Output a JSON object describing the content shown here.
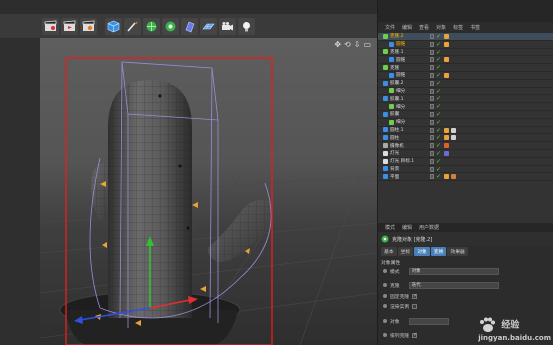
{
  "toolbar": {
    "icons": [
      "film-clapper-icon",
      "film-play-icon",
      "film-settings-icon",
      "cube-icon",
      "brush-icon",
      "subdivide-icon",
      "atom-array-icon",
      "deformer-icon",
      "floor-grid-icon",
      "camera-icon",
      "light-bulb-icon"
    ]
  },
  "viewport": {
    "nav_icons": [
      "✥",
      "⟲",
      "⇩",
      "▭"
    ]
  },
  "object_manager": {
    "menu": [
      "文件",
      "编辑",
      "查看",
      "对象",
      "标签",
      "书签"
    ],
    "rows": [
      {
        "name": "克隆.2",
        "indent": 0,
        "icon_color": "#6fce4c",
        "highlight": true,
        "selected": true,
        "tags": [
          "#e8a33a"
        ]
      },
      {
        "name": "圆锥",
        "indent": 1,
        "icon_color": "#3a8ee6",
        "highlight": true,
        "selected": false,
        "tags": [
          "#e8a33a"
        ]
      },
      {
        "name": "克隆.1",
        "indent": 0,
        "icon_color": "#6fce4c",
        "highlight": false,
        "selected": false,
        "tags": []
      },
      {
        "name": "圆锥",
        "indent": 1,
        "icon_color": "#3a8ee6",
        "highlight": false,
        "selected": false,
        "tags": [
          "#e8a33a"
        ]
      },
      {
        "name": "克隆",
        "indent": 0,
        "icon_color": "#6fce4c",
        "highlight": false,
        "selected": false,
        "tags": []
      },
      {
        "name": "圆锥",
        "indent": 1,
        "icon_color": "#3a8ee6",
        "highlight": false,
        "selected": false,
        "tags": [
          "#e8a33a"
        ]
      },
      {
        "name": "胶囊.2",
        "indent": 0,
        "icon_color": "#3a8ee6",
        "highlight": false,
        "selected": false,
        "tags": []
      },
      {
        "name": "细分",
        "indent": 1,
        "icon_color": "#6fce4c",
        "highlight": false,
        "selected": false,
        "tags": []
      },
      {
        "name": "胶囊.1",
        "indent": 0,
        "icon_color": "#3a8ee6",
        "highlight": false,
        "selected": false,
        "tags": []
      },
      {
        "name": "细分",
        "indent": 1,
        "icon_color": "#6fce4c",
        "highlight": false,
        "selected": false,
        "tags": []
      },
      {
        "name": "胶囊",
        "indent": 0,
        "icon_color": "#3a8ee6",
        "highlight": false,
        "selected": false,
        "tags": []
      },
      {
        "name": "细分",
        "indent": 1,
        "icon_color": "#6fce4c",
        "highlight": false,
        "selected": false,
        "tags": []
      },
      {
        "name": "圆柱.1",
        "indent": 0,
        "icon_color": "#3a8ee6",
        "highlight": false,
        "selected": false,
        "tags": [
          "#e8a33a",
          "#d0d0d0"
        ]
      },
      {
        "name": "圆柱",
        "indent": 0,
        "icon_color": "#3a8ee6",
        "highlight": false,
        "selected": false,
        "tags": [
          "#e8a33a",
          "#d0d0d0"
        ]
      },
      {
        "name": "摄像机",
        "indent": 0,
        "icon_color": "#aaaaaa",
        "highlight": false,
        "selected": false,
        "tags": [
          "#e06030"
        ]
      },
      {
        "name": "灯光",
        "indent": 0,
        "icon_color": "#dddddd",
        "highlight": false,
        "selected": false,
        "tags": [
          "#6a6ad8"
        ]
      },
      {
        "name": "灯光.目标.1",
        "indent": 0,
        "icon_color": "#dddddd",
        "highlight": false,
        "selected": false,
        "tags": []
      },
      {
        "name": "背景",
        "indent": 0,
        "icon_color": "#3a8ee6",
        "highlight": false,
        "selected": false,
        "tags": []
      },
      {
        "name": "平面",
        "indent": 0,
        "icon_color": "#3a8ee6",
        "highlight": false,
        "selected": false,
        "tags": [
          "#e8a33a",
          "#d08040"
        ]
      }
    ]
  },
  "attributes": {
    "menu": [
      "模式",
      "编辑",
      "用户数据"
    ],
    "title": "克隆对象 [克隆.2]",
    "tabs": [
      {
        "label": "基本",
        "active": false
      },
      {
        "label": "坐标",
        "active": false
      },
      {
        "label": "对象",
        "active": true
      },
      {
        "label": "变换",
        "active": true
      },
      {
        "label": "效果器",
        "active": false
      }
    ],
    "section_title": "对象属性",
    "mode_label": "模式",
    "mode_value": "对象",
    "clone_label": "克隆",
    "clone_value": "迭代",
    "fixed_clone_label": "固定克隆",
    "fixed_clone_check": "✓",
    "instance_label": "渲染实例",
    "object_label": "对象",
    "sort_label": "排列克隆",
    "sort_check": "✓"
  },
  "watermark": {
    "line1": "经验",
    "line2": "jingyan.baidu.com"
  },
  "colors": {
    "selection_box": "#e02020",
    "bbox": "#9a8cd8",
    "axis_y": "#30c030",
    "axis_x": "#e03030",
    "axis_z": "#3050e0",
    "accent_tab": "#4a7fb8"
  }
}
